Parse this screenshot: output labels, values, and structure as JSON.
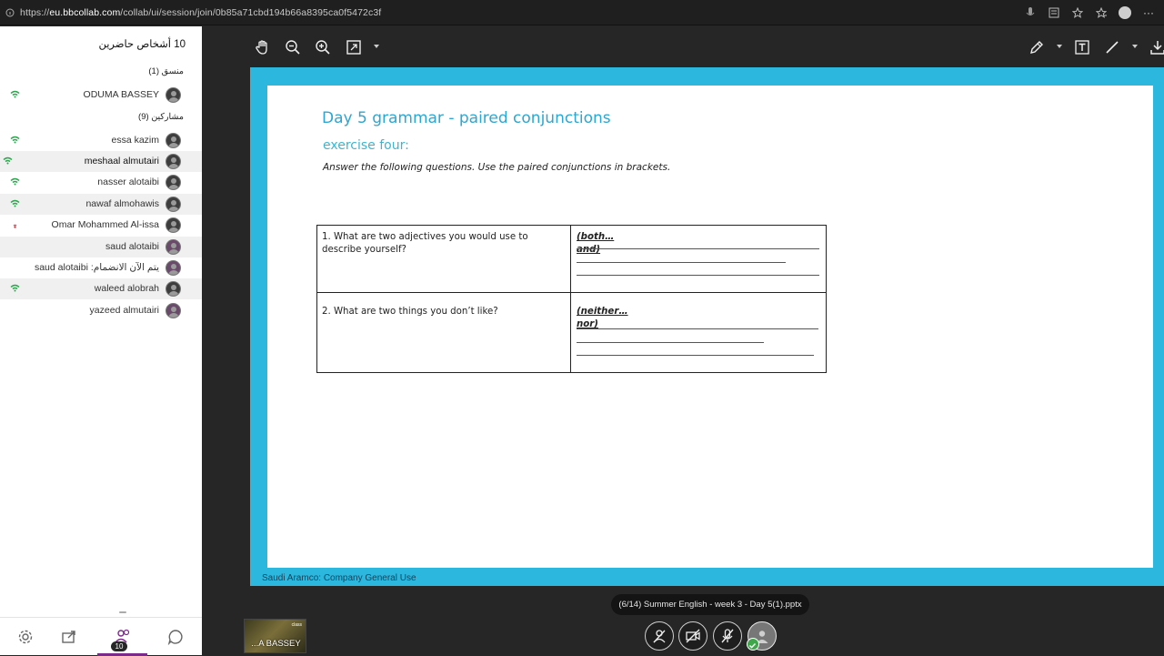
{
  "browser": {
    "url_prefix": "https://",
    "url_domain": "eu.bbcollab.com",
    "url_path": "/collab/ui/session/join/0b85a71cbd194b66a8395ca0f5472c3f"
  },
  "panel": {
    "title": "10 أشخاص حاضرين",
    "moderators_label": "منسق (1)",
    "participants_label": "مشاركين (9)",
    "moderators": [
      {
        "name": "ODUMA BASSEY",
        "signal": "good"
      }
    ],
    "participants": [
      {
        "name": "essa kazim",
        "signal": "good",
        "highlight": false
      },
      {
        "name": "meshaal almutairi",
        "signal": "good",
        "highlight": true
      },
      {
        "name": "nasser alotaibi",
        "signal": "good",
        "highlight": false
      },
      {
        "name": "nawaf almohawis",
        "signal": "good",
        "highlight": true
      },
      {
        "name": "Omar Mohammed Al-issa",
        "signal": "poor",
        "highlight": false
      },
      {
        "name": "saud alotaibi",
        "signal": "none",
        "highlight": true
      },
      {
        "name": "saud alotaibi :يتم الآن الانضمام",
        "signal": "none",
        "highlight": false
      },
      {
        "name": "waleed alobrah",
        "signal": "good",
        "highlight": true
      },
      {
        "name": "yazeed almutairi",
        "signal": "none",
        "highlight": false
      }
    ],
    "footer": {
      "attendee_count_badge": "10"
    }
  },
  "slide": {
    "title": "Day 5 grammar - paired conjunctions",
    "subtitle": "exercise four:",
    "instruction": "Answer the following questions. Use the paired conjunctions in brackets.",
    "rows": [
      {
        "question": "1. What are two adjectives you would use to describe yourself?",
        "answer_line1": "(both…",
        "answer_line2": "and)"
      },
      {
        "question": "2. What are two things you don’t like?",
        "answer_line1": "(neither…",
        "answer_line2": "nor)"
      }
    ],
    "footer": "Saudi Aramco: Company General Use"
  },
  "bottom": {
    "file_label": "(6/14)   Summer English - week 3 - Day 5(1).pptx",
    "presenter_thumb_name": "...A BASSEY",
    "thumb_tag": "class"
  },
  "colors": {
    "slide_border": "#2bb7de",
    "title": "#2aa7d3",
    "signal_good": "#2ea44f",
    "signal_poor": "#d9363e",
    "active_tab": "#7b2a8a"
  }
}
